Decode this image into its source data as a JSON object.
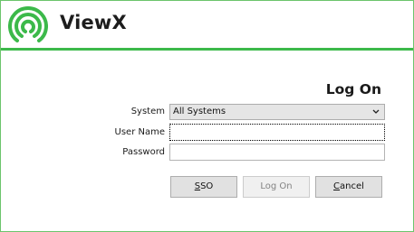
{
  "app": {
    "brand_name": "ViewX",
    "icon": "wifi-signal-icon",
    "accent_color": "#3cb94a"
  },
  "login": {
    "title": "Log On",
    "system_label": "System",
    "system_value": "All Systems",
    "username_label": "User Name",
    "username_value": "",
    "password_label": "Password",
    "password_value": ""
  },
  "buttons": {
    "sso": {
      "mnemonic": "S",
      "rest": "SO"
    },
    "logon": {
      "mnemonic": "",
      "rest": "Log On",
      "enabled": false
    },
    "cancel": {
      "mnemonic": "C",
      "rest": "ancel"
    }
  }
}
